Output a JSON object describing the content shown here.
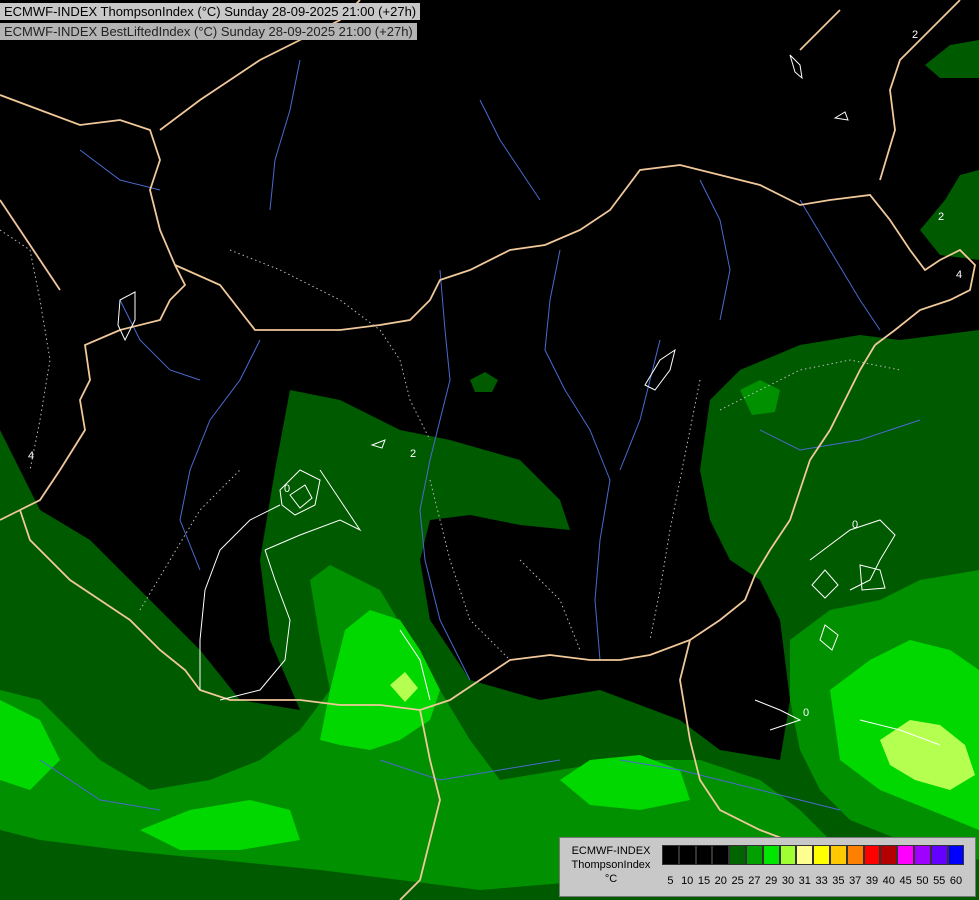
{
  "header": {
    "title_line_1": "ECMWF-INDEX ThompsonIndex (°C) Sunday 28-09-2025 21:00 (+27h)",
    "title_line_2": "ECMWF-INDEX BestLiftedIndex (°C) Sunday 28-09-2025 21:00 (+27h)"
  },
  "contour_labels": [
    "4",
    "2",
    "0",
    "0",
    "0",
    "2",
    "2",
    "4"
  ],
  "legend": {
    "line_1": "ECMWF-INDEX",
    "line_2": "ThompsonIndex",
    "line_3": "°C",
    "ticks": [
      "5",
      "10",
      "15",
      "20",
      "25",
      "27",
      "29",
      "30",
      "31",
      "33",
      "35",
      "37",
      "39",
      "40",
      "45",
      "50",
      "55",
      "60"
    ],
    "colors": [
      "#000000",
      "#000000",
      "#000000",
      "#000000",
      "#006400",
      "#00a000",
      "#00e600",
      "#a0ff32",
      "#ffff90",
      "#ffff00",
      "#ffc800",
      "#ff8000",
      "#ff0000",
      "#b40000",
      "#ff00ff",
      "#a000ff",
      "#6400ff",
      "#0000ff"
    ]
  },
  "colors": {
    "border": "#f0c89a",
    "river": "#4a6ad0",
    "dark_green": "#005a00",
    "mid_green": "#009000",
    "bright_green": "#00d800",
    "yellow_green": "#b4ff50"
  }
}
